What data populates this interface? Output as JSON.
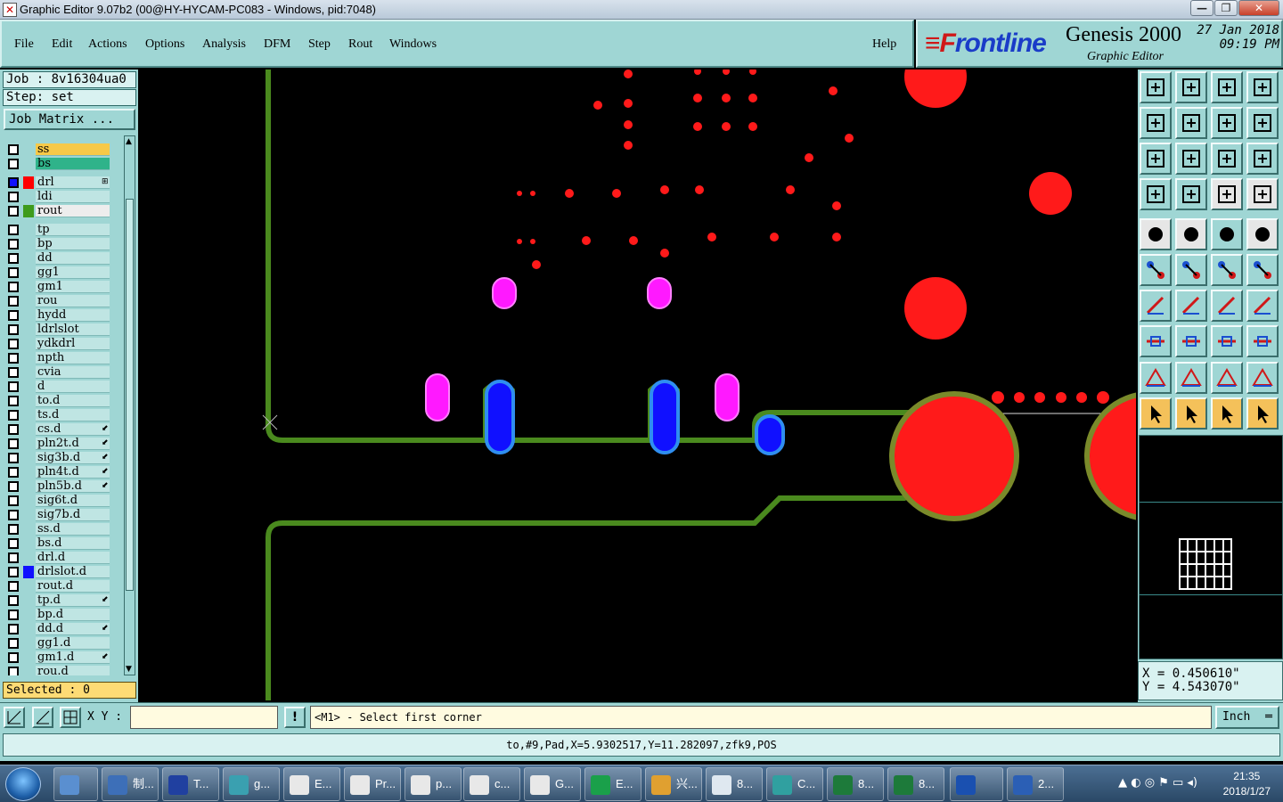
{
  "window": {
    "title": "Graphic Editor 9.07b2 (00@HY-HYCAM-PC083 - Windows, pid:7048)",
    "minimize": "—",
    "restore": "❐",
    "close": "✕"
  },
  "menu": {
    "items": [
      "File",
      "Edit",
      "Actions",
      "Options",
      "Analysis",
      "DFM",
      "Step",
      "Rout",
      "Windows"
    ],
    "help": "Help"
  },
  "brand": {
    "logo_f": "≡F",
    "logo_rest": "rontline",
    "product": "Genesis 2000",
    "subtitle": "Graphic Editor",
    "date": "27 Jan 2018",
    "time": "09:19 PM"
  },
  "job": {
    "job_line": "Job : 8v16304ua0",
    "step_line": "Step: set",
    "matrix_button": "Job Matrix ..."
  },
  "layers": [
    {
      "name": "ss",
      "bg": "#f7c948",
      "swatch": "",
      "tick": ""
    },
    {
      "name": "bs",
      "bg": "#2fb38a",
      "swatch": "",
      "tick": ""
    },
    {
      "name": "drl",
      "bg": "#bfe5e3",
      "swatch": "#ff0000",
      "tick": "⊞",
      "selected": true
    },
    {
      "name": "ldi",
      "bg": "#bfe5e3",
      "swatch": "",
      "tick": ""
    },
    {
      "name": "rout",
      "bg": "#ededed",
      "swatch": "#3e9b1c",
      "tick": ""
    },
    {
      "name": "tp",
      "bg": "#bfe5e3",
      "swatch": "",
      "tick": ""
    },
    {
      "name": "bp",
      "bg": "#bfe5e3",
      "swatch": "",
      "tick": ""
    },
    {
      "name": "dd",
      "bg": "#bfe5e3",
      "swatch": "",
      "tick": ""
    },
    {
      "name": "gg1",
      "bg": "#bfe5e3",
      "swatch": "",
      "tick": ""
    },
    {
      "name": "gm1",
      "bg": "#bfe5e3",
      "swatch": "",
      "tick": ""
    },
    {
      "name": "rou",
      "bg": "#bfe5e3",
      "swatch": "",
      "tick": ""
    },
    {
      "name": "hydd",
      "bg": "#bfe5e3",
      "swatch": "",
      "tick": ""
    },
    {
      "name": "ldrlslot",
      "bg": "#bfe5e3",
      "swatch": "",
      "tick": ""
    },
    {
      "name": "ydkdrl",
      "bg": "#bfe5e3",
      "swatch": "",
      "tick": ""
    },
    {
      "name": "npth",
      "bg": "#bfe5e3",
      "swatch": "",
      "tick": ""
    },
    {
      "name": "cvia",
      "bg": "#bfe5e3",
      "swatch": "",
      "tick": ""
    },
    {
      "name": "d",
      "bg": "#bfe5e3",
      "swatch": "",
      "tick": ""
    },
    {
      "name": "to.d",
      "bg": "#bfe5e3",
      "swatch": "",
      "tick": ""
    },
    {
      "name": "ts.d",
      "bg": "#bfe5e3",
      "swatch": "",
      "tick": ""
    },
    {
      "name": "cs.d",
      "bg": "#bfe5e3",
      "swatch": "",
      "tick": "⬋"
    },
    {
      "name": "pln2t.d",
      "bg": "#bfe5e3",
      "swatch": "",
      "tick": "⬋"
    },
    {
      "name": "sig3b.d",
      "bg": "#bfe5e3",
      "swatch": "",
      "tick": "⬋"
    },
    {
      "name": "pln4t.d",
      "bg": "#bfe5e3",
      "swatch": "",
      "tick": "⬋"
    },
    {
      "name": "pln5b.d",
      "bg": "#bfe5e3",
      "swatch": "",
      "tick": "⬋"
    },
    {
      "name": "sig6t.d",
      "bg": "#bfe5e3",
      "swatch": "",
      "tick": ""
    },
    {
      "name": "sig7b.d",
      "bg": "#bfe5e3",
      "swatch": "",
      "tick": ""
    },
    {
      "name": "ss.d",
      "bg": "#bfe5e3",
      "swatch": "",
      "tick": ""
    },
    {
      "name": "bs.d",
      "bg": "#bfe5e3",
      "swatch": "",
      "tick": ""
    },
    {
      "name": "drl.d",
      "bg": "#bfe5e3",
      "swatch": "",
      "tick": ""
    },
    {
      "name": "drlslot.d",
      "bg": "#bfe5e3",
      "swatch": "#1010ff",
      "tick": ""
    },
    {
      "name": "rout.d",
      "bg": "#bfe5e3",
      "swatch": "",
      "tick": ""
    },
    {
      "name": "tp.d",
      "bg": "#bfe5e3",
      "swatch": "",
      "tick": "⬋"
    },
    {
      "name": "bp.d",
      "bg": "#bfe5e3",
      "swatch": "",
      "tick": ""
    },
    {
      "name": "dd.d",
      "bg": "#bfe5e3",
      "swatch": "",
      "tick": "⬋"
    },
    {
      "name": "gg1.d",
      "bg": "#bfe5e3",
      "swatch": "",
      "tick": ""
    },
    {
      "name": "gm1.d",
      "bg": "#bfe5e3",
      "swatch": "",
      "tick": "⬋"
    },
    {
      "name": "rou.d",
      "bg": "#bfe5e3",
      "swatch": "",
      "tick": ""
    }
  ],
  "selected_label": "Selected : 0",
  "coords": {
    "x": "X = 0.450610\"",
    "y": "Y = 4.543070\""
  },
  "command": {
    "xy_label": "X Y :",
    "xy_value": "",
    "prompt": "<M1> - Select first corner",
    "unit": "Inch",
    "alert": "!"
  },
  "status_line": "to,#9,Pad,X=5.9302517,Y=11.282097,zfk9,POS",
  "taskbar": {
    "items": [
      {
        "label": "",
        "color": "#5a8fd0"
      },
      {
        "label": "",
        "color": "#4f7fc6"
      },
      {
        "label": "制...",
        "color": "#3d6fb8"
      },
      {
        "label": "T...",
        "color": "#2040a0"
      },
      {
        "label": "g...",
        "color": "#3aa0b0"
      },
      {
        "label": "E...",
        "color": "#e8e8e8"
      },
      {
        "label": "Pr...",
        "color": "#e8e8e8"
      },
      {
        "label": "p...",
        "color": "#e8e8e8"
      },
      {
        "label": "c...",
        "color": "#e8e8e8"
      },
      {
        "label": "G...",
        "color": "#e8e8e8"
      },
      {
        "label": "E...",
        "color": "#1aa04a"
      },
      {
        "label": "兴...",
        "color": "#e0a030"
      },
      {
        "label": "8...",
        "color": "#dfe8f0"
      },
      {
        "label": "C...",
        "color": "#30a0a0"
      },
      {
        "label": "8...",
        "color": "#1d7a3a"
      },
      {
        "label": "8...",
        "color": "#1d7a3a"
      },
      {
        "label": "",
        "color": "#1a50b0"
      },
      {
        "label": "2...",
        "color": "#2b5fb5"
      }
    ],
    "time": "21:35",
    "date": "2018/1/27"
  }
}
